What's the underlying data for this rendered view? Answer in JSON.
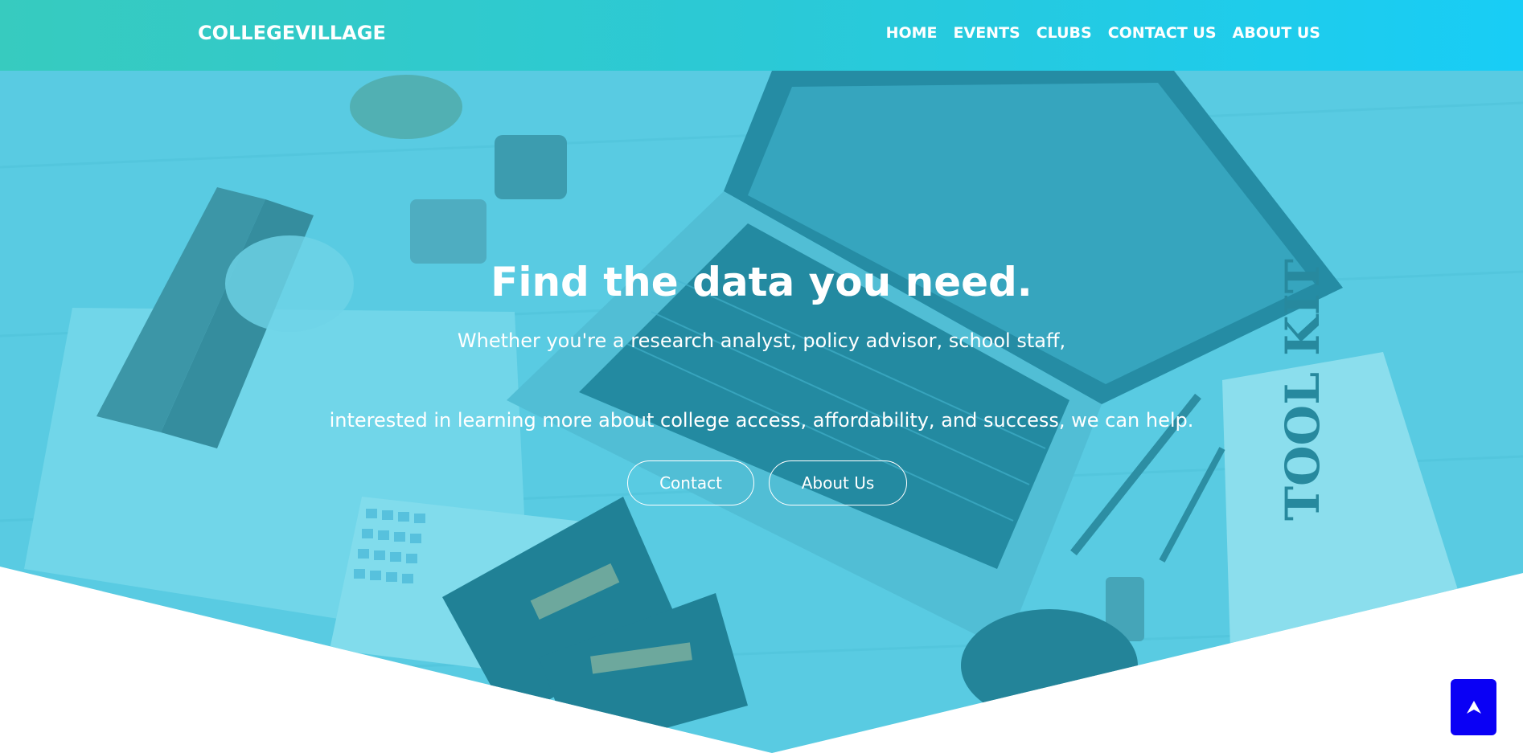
{
  "navbar": {
    "brand": "COLLEGEVILLAGE",
    "items": [
      {
        "label": "HOME"
      },
      {
        "label": "EVENTS"
      },
      {
        "label": "CLUBS"
      },
      {
        "label": "CONTACT US"
      },
      {
        "label": "ABOUT US"
      }
    ]
  },
  "hero": {
    "title": "Find the data you need.",
    "line1": "Whether you're a research analyst, policy advisor, school staff,",
    "line2": "interested in learning more about college access, affordability, and success, we can help.",
    "buttons": {
      "contact": "Contact",
      "about": "About Us"
    },
    "overlay_color": "#2cc6df"
  },
  "scroll_top": {
    "icon": "arrow-up-icon",
    "color": "#0a00f5"
  },
  "colors": {
    "nav_gradient_start": "#37cbbf",
    "nav_gradient_end": "#18cdf6",
    "text": "#ffffff"
  }
}
